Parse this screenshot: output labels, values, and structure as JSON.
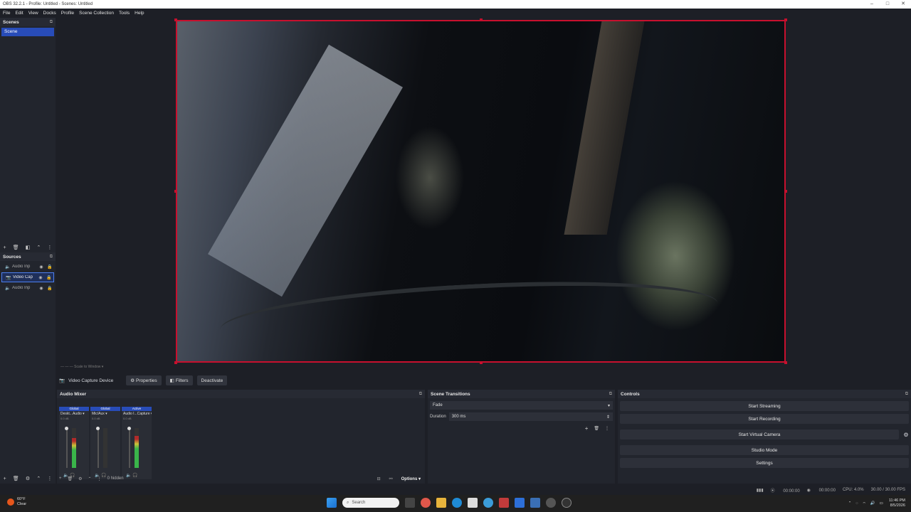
{
  "window": {
    "title": "OBS 32.2.1 - Profile: Untitled - Scenes: Untitled"
  },
  "menu": [
    "File",
    "Edit",
    "View",
    "Docks",
    "Profile",
    "Scene Collection",
    "Tools",
    "Help"
  ],
  "scenes": {
    "title": "Scenes",
    "items": [
      "Scene"
    ]
  },
  "sources": {
    "title": "Sources",
    "items": [
      {
        "name": "Audio Inp",
        "icon": "speaker-icon",
        "selected": false
      },
      {
        "name": "Video Cap",
        "icon": "camera-icon",
        "selected": true
      },
      {
        "name": "Audio Inp",
        "icon": "speaker-icon",
        "selected": false
      }
    ]
  },
  "below_preview": "—  —  —  Scale to Window  ▾",
  "context": {
    "source_label": "Video Capture Device",
    "properties": "Properties",
    "filters": "Filters",
    "deactivate": "Deactivate"
  },
  "mixer": {
    "title": "Audio Mixer",
    "channels": [
      {
        "status": "Global",
        "name": "Deskt...Audio",
        "db": "0.0 dB",
        "level": 0.75,
        "color": "#3ab54a"
      },
      {
        "status": "Global",
        "name": "Mic/Aux",
        "db": "0.0 dB",
        "level": 0.0,
        "color": "#555555"
      },
      {
        "status": "Active",
        "name": "Audio I...Capture",
        "db": "0.0 dB",
        "level": 0.8,
        "color": "#3ab54a"
      }
    ],
    "hidden_label": "0 hidden",
    "options_label": "Options"
  },
  "transitions": {
    "title": "Scene Transitions",
    "selected": "Fade",
    "duration_label": "Duration",
    "duration_value": "300 ms"
  },
  "controls": {
    "title": "Controls",
    "buttons": [
      "Start Streaming",
      "Start Recording",
      "Start Virtual Camera",
      "Studio Mode",
      "Settings"
    ]
  },
  "status": {
    "time1": "00:00:00",
    "time2": "00:00:00",
    "cpu": "CPU: 4.0%",
    "fps": "30.00 / 30.00 FPS"
  },
  "taskbar": {
    "weather_temp": "60°F",
    "weather_desc": "Clear",
    "search_placeholder": "Search",
    "time": "11:46 PM",
    "date": "8/5/2026"
  },
  "colors": {
    "accent": "#284cb8",
    "preview_border": "#c8102e"
  }
}
